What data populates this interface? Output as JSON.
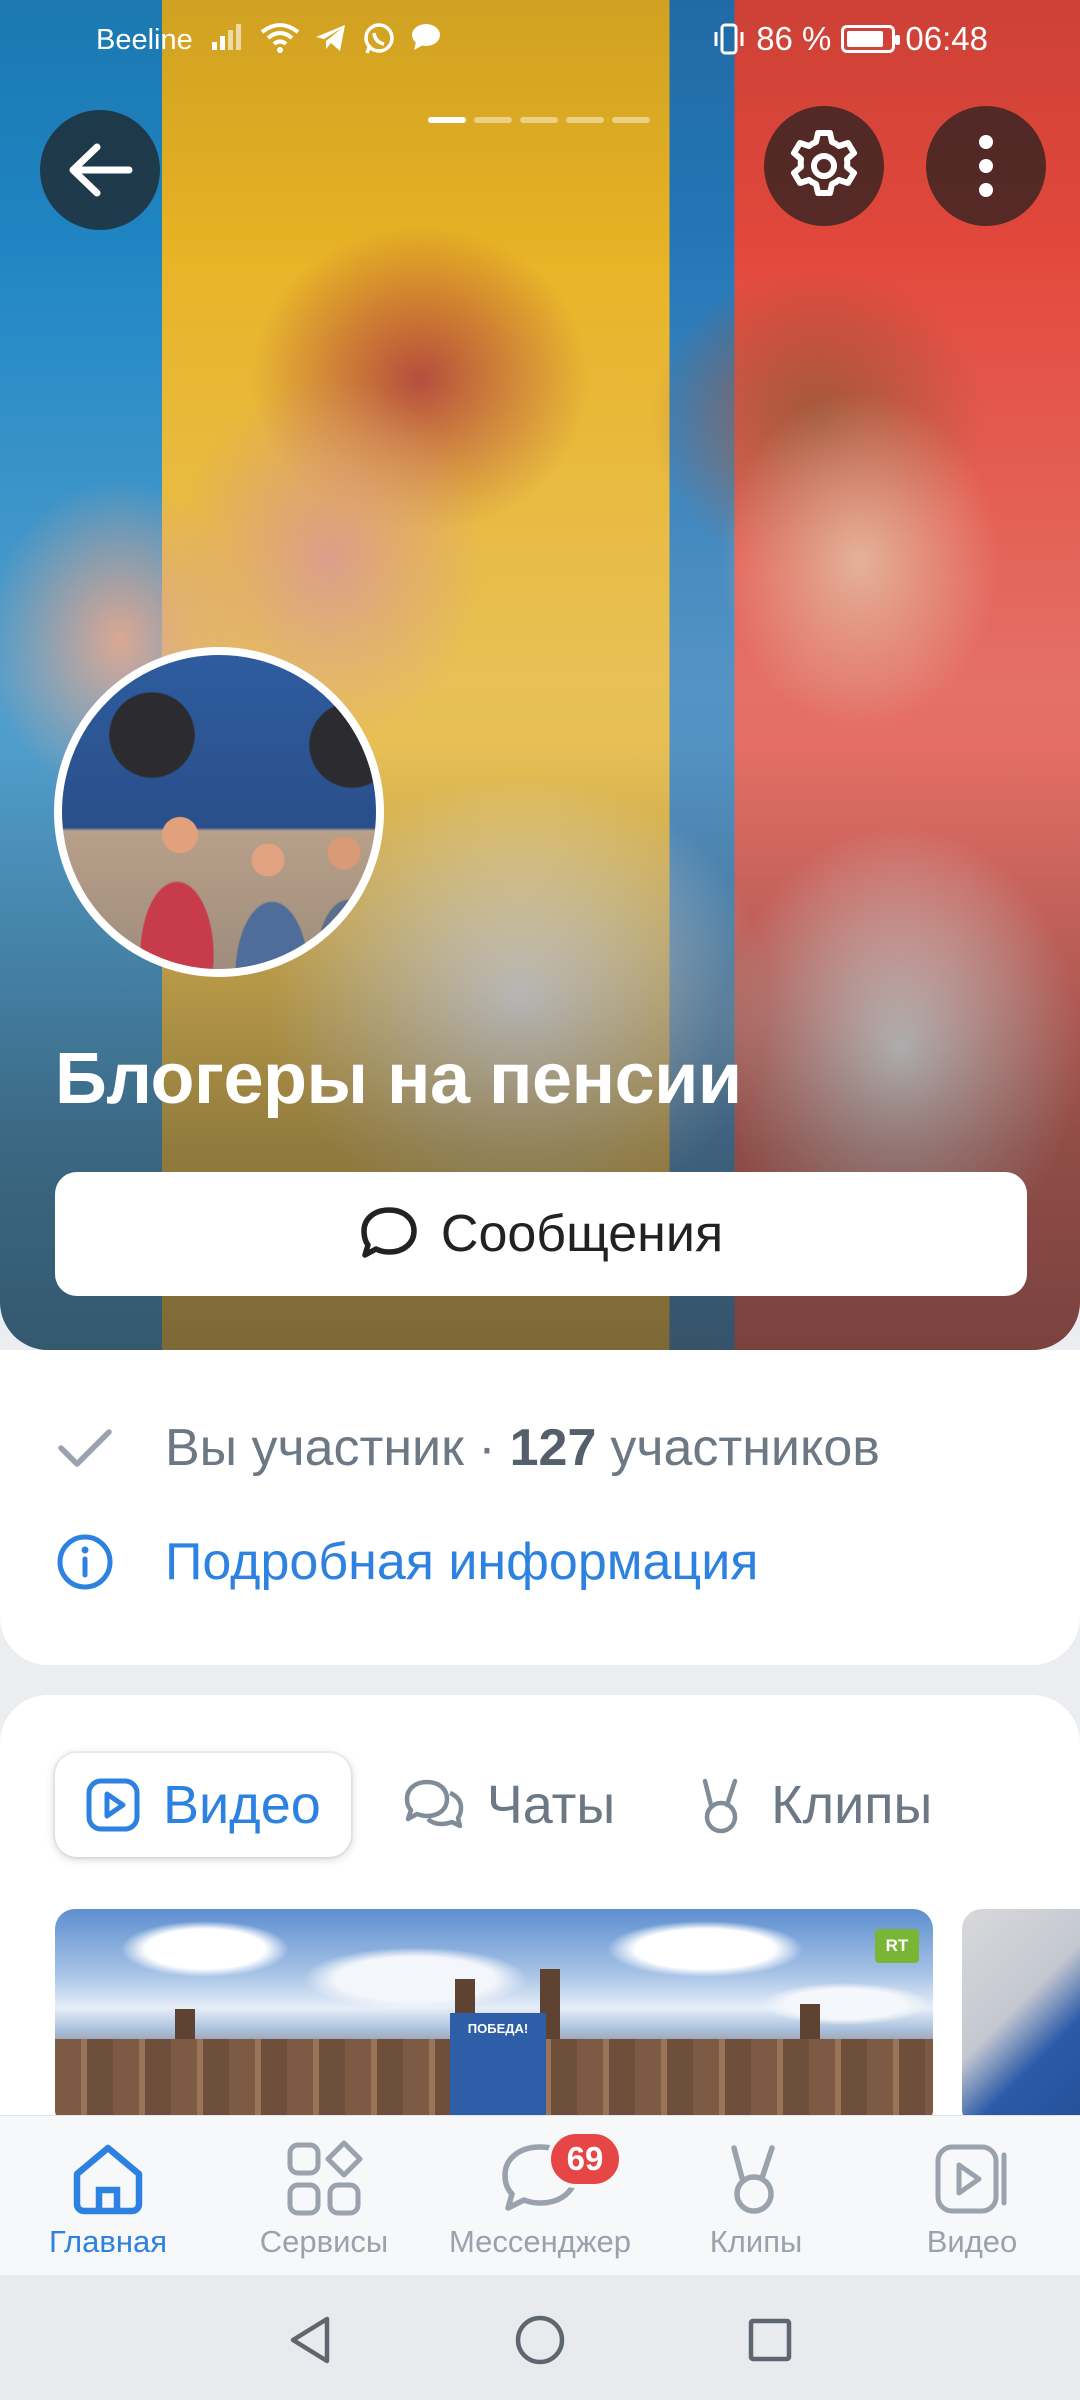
{
  "status_bar": {
    "carrier": "Beeline",
    "battery_percent": "86 %",
    "battery_level": 0.86,
    "time": "06:48"
  },
  "top_bar": {
    "icons": [
      "back-arrow-icon",
      "gear-icon",
      "more-vertical-icon"
    ]
  },
  "group": {
    "name": "Блогеры на пенсии",
    "messages_button": "Сообщения",
    "member_status": "Вы участник ·",
    "member_count": "127",
    "member_word": "участников",
    "details_link": "Подробная информация"
  },
  "content_tabs": [
    {
      "label": "Видео",
      "icon": "video-icon",
      "active": true
    },
    {
      "label": "Чаты",
      "icon": "chats-icon",
      "active": false
    },
    {
      "label": "Клипы",
      "icon": "clips-icon",
      "active": false
    }
  ],
  "video_preview": {
    "banner_text": "ПОБЕДА!",
    "channel_badge": "RT"
  },
  "bottom_nav": [
    {
      "label": "Главная",
      "icon": "home-icon",
      "active": true
    },
    {
      "label": "Сервисы",
      "icon": "services-icon",
      "active": false
    },
    {
      "label": "Мессенджер",
      "icon": "messenger-icon",
      "active": false,
      "badge": "69"
    },
    {
      "label": "Клипы",
      "icon": "clips-icon",
      "active": false
    },
    {
      "label": "Видео",
      "icon": "video-icon",
      "active": false
    }
  ],
  "colors": {
    "accent": "#2d81e0",
    "badge": "#e64646",
    "muted_text": "#6d7885"
  }
}
